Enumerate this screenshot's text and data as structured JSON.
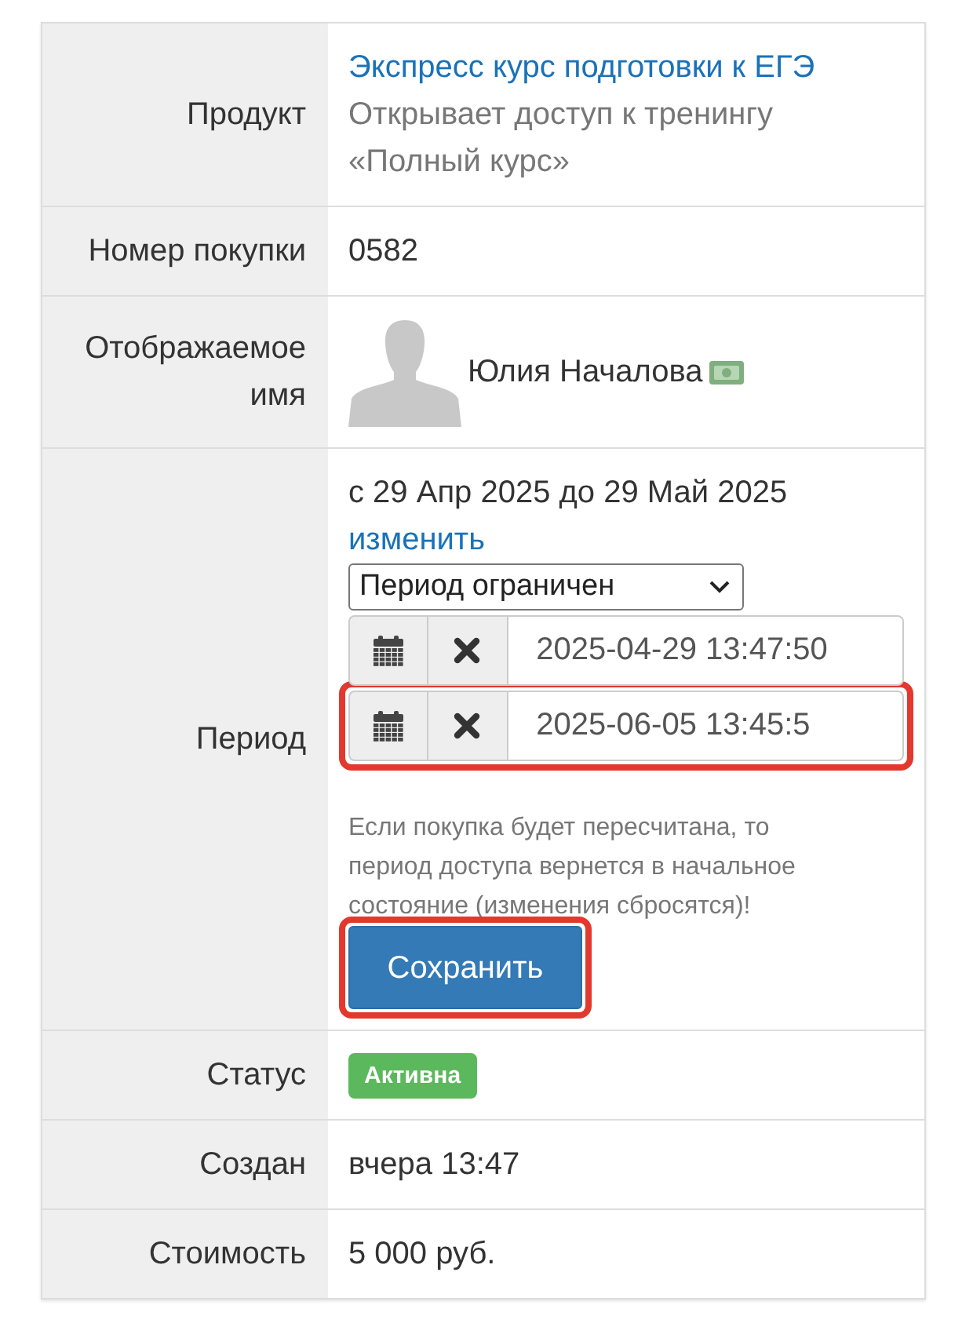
{
  "fields": [
    {
      "kind": "product",
      "label": "Продукт",
      "link": "Экспресс курс подготовки к ЕГЭ",
      "description": "Открывает доступ к тренингу «Полный курс»"
    },
    {
      "kind": "text",
      "label": "Номер покупки",
      "value": "0582"
    },
    {
      "kind": "user",
      "label": "Отображаемое имя",
      "name": "Юлия Началова"
    },
    {
      "kind": "period",
      "label": "Период",
      "summary": "с 29 Апр 2025 до 29 Май 2025",
      "change_link": "изменить",
      "period_type": "Период ограничен",
      "date_fields": [
        {
          "value": "2025-04-29 13:47:50",
          "highlighted": false
        },
        {
          "value": "2025-06-05 13:45:5",
          "highlighted": true
        }
      ],
      "note": "Если покупка будет пересчитана, то период доступа вернется в начальное состояние (изменения сбросятся)!",
      "save_button": {
        "label": "Сохранить",
        "highlighted": true
      }
    },
    {
      "kind": "badge",
      "label": "Статус",
      "value": "Активна"
    },
    {
      "kind": "text",
      "label": "Создан",
      "value": "вчера 13:47"
    },
    {
      "kind": "text",
      "label": "Стоимость",
      "value": "5 000 руб."
    }
  ]
}
